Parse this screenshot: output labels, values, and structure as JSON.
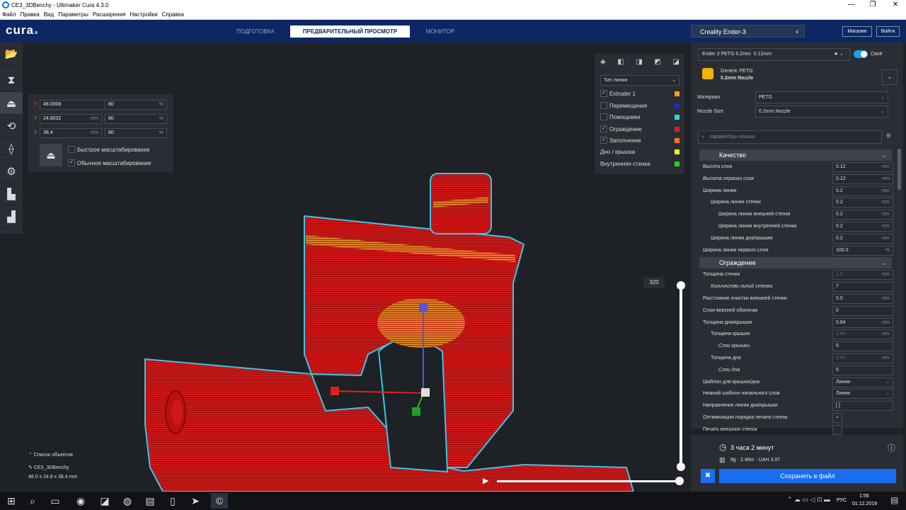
{
  "window": {
    "title": "CE3_3DBenchy - Ultimaker Cura 4.3.0",
    "min_icon": "minimize-icon",
    "max_icon": "maximize-icon",
    "close_icon": "close-icon"
  },
  "menu": [
    "Файл",
    "Правка",
    "Вид",
    "Параметры",
    "Расширения",
    "Настройки",
    "Справка"
  ],
  "header": {
    "logo": "cura",
    "stages": [
      "ПОДГОТОВКА",
      "ПРЕДВАРИТЕЛЬНЫЙ ПРОСМОТР",
      "МОНИТОР"
    ],
    "active_stage": "ПРЕДВАРИТЕЛЬНЫЙ ПРОСМОТР",
    "printer": "Creality Ender-3",
    "marketplace": "Магазин",
    "signin": "Войти"
  },
  "tools": [
    "open-file-icon",
    "move-tool-icon",
    "scale-tool-icon",
    "rotate-tool-icon",
    "mirror-tool-icon",
    "per-model-settings-icon",
    "support-blocker-icon",
    "layer-view-icon"
  ],
  "scale": {
    "x": {
      "axis": "X",
      "value": "48.0008",
      "unit": "mm",
      "percent": "80",
      "pct": "%"
    },
    "y": {
      "axis": "Y",
      "value": "24.8032",
      "unit": "mm",
      "percent": "80",
      "pct": "%"
    },
    "z": {
      "axis": "Z",
      "value": "38.4",
      "unit": "mm",
      "percent": "80",
      "pct": "%"
    },
    "snap": "Быстрое масштабирование",
    "uniform": "Обычное масштабирование",
    "uniform_checked": "✓"
  },
  "viewpanel": {
    "mode": "Тип линии",
    "items": [
      {
        "label": "Extruder 1",
        "color": "#f2a01d",
        "checked": "✓"
      },
      {
        "label": "Перемещения",
        "color": "#1030dd",
        "checked": ""
      },
      {
        "label": "Помощники",
        "color": "#16e0e5",
        "checked": ""
      },
      {
        "label": "Ограждение",
        "color": "#e02020",
        "checked": "✓"
      },
      {
        "label": "Заполнение",
        "color": "#f07818",
        "checked": "✓"
      },
      {
        "label": "Дно / крышка",
        "color": "#f0f020",
        "checked": ""
      },
      {
        "label": "Внутренняя стенка",
        "color": "#18d818",
        "checked": ""
      }
    ]
  },
  "layer": {
    "current": "320"
  },
  "objects": {
    "toggle": "Список объектов",
    "name": "CE3_3DBenchy",
    "dims": "48.0 x 24.8 x 38.4 mm"
  },
  "profile": {
    "name": "Ender 3 PETG 0.2mm",
    "layer": "0.12mm",
    "custom": "Своё",
    "material_brand": "Generic PETG",
    "nozzle": "0.2mm Nozzle",
    "material_label": "Материал",
    "material": "PETG",
    "nozzle_label": "Nozzle Size",
    "nozzle_value": "0.2mm Nozzle",
    "search_placeholder": "параметры поиска"
  },
  "settings": [
    {
      "type": "cat",
      "label": "Качество"
    },
    {
      "label": "Высота слоя",
      "value": "0.12",
      "unit": "mm",
      "indent": 0
    },
    {
      "label": "Высота первого слоя",
      "value": "0.12",
      "unit": "mm",
      "indent": 0,
      "italic": true
    },
    {
      "label": "Ширина линии",
      "value": "0.2",
      "unit": "mm",
      "indent": 0
    },
    {
      "label": "Ширина линии стенки",
      "value": "0.2",
      "unit": "mm",
      "indent": 1
    },
    {
      "label": "Ширина линии внешней стенки",
      "value": "0.2",
      "unit": "mm",
      "indent": 2
    },
    {
      "label": "Ширина линии внутренней стенки",
      "value": "0.2",
      "unit": "mm",
      "indent": 2
    },
    {
      "label": "Ширина линии дна/крышки",
      "value": "0.2",
      "unit": "mm",
      "indent": 1
    },
    {
      "label": "Ширина линии первого слоя",
      "value": "100.0",
      "unit": "%",
      "indent": 0
    },
    {
      "type": "cat",
      "label": "Ограждение"
    },
    {
      "label": "Толщина стенки",
      "value": "1.6",
      "unit": "mm",
      "indent": 0,
      "dim": true
    },
    {
      "label": "Количество линий стенки",
      "value": "7",
      "unit": "",
      "indent": 1,
      "italic": true
    },
    {
      "label": "Расстояние очистки внешней стенки",
      "value": "0.0",
      "unit": "mm",
      "indent": 0
    },
    {
      "label": "Слои верхней оболочки",
      "value": "0",
      "unit": "",
      "indent": 0
    },
    {
      "label": "Толщина дна/крышки",
      "value": "0.84",
      "unit": "mm",
      "indent": 0
    },
    {
      "label": "Толщина крышки",
      "value": "0.84",
      "unit": "mm",
      "indent": 1,
      "dim": true
    },
    {
      "label": "Слои крышки",
      "value": "5",
      "unit": "",
      "indent": 2,
      "italic": true
    },
    {
      "label": "Толщина дна",
      "value": "0.84",
      "unit": "mm",
      "indent": 1,
      "dim": true
    },
    {
      "label": "Слои дна",
      "value": "5",
      "unit": "",
      "indent": 2,
      "italic": true
    },
    {
      "label": "Шаблон для крышки/дна",
      "value": "Линии",
      "unit": "",
      "indent": 0,
      "select": true
    },
    {
      "label": "Нижний шаблон начального слоя",
      "value": "Линии",
      "unit": "",
      "indent": 0,
      "select": true
    },
    {
      "label": "Направление линии дна/крышки",
      "value": "[ ]",
      "unit": "",
      "indent": 0
    },
    {
      "label": "Оптимизация порядка печати стенок",
      "value": "✓",
      "unit": "",
      "indent": 0,
      "check": true
    },
    {
      "label": "Печать внешних стенок",
      "value": "",
      "unit": "",
      "indent": 0,
      "check": true
    }
  ],
  "estimate": {
    "time": "3 часа 2 минут",
    "material": "8g · 2.48m · UAH 3.07",
    "save": "Сохранить в файл"
  },
  "taskbar": {
    "lang": "РУС",
    "time": "1:56",
    "date": "01.12.2019"
  }
}
